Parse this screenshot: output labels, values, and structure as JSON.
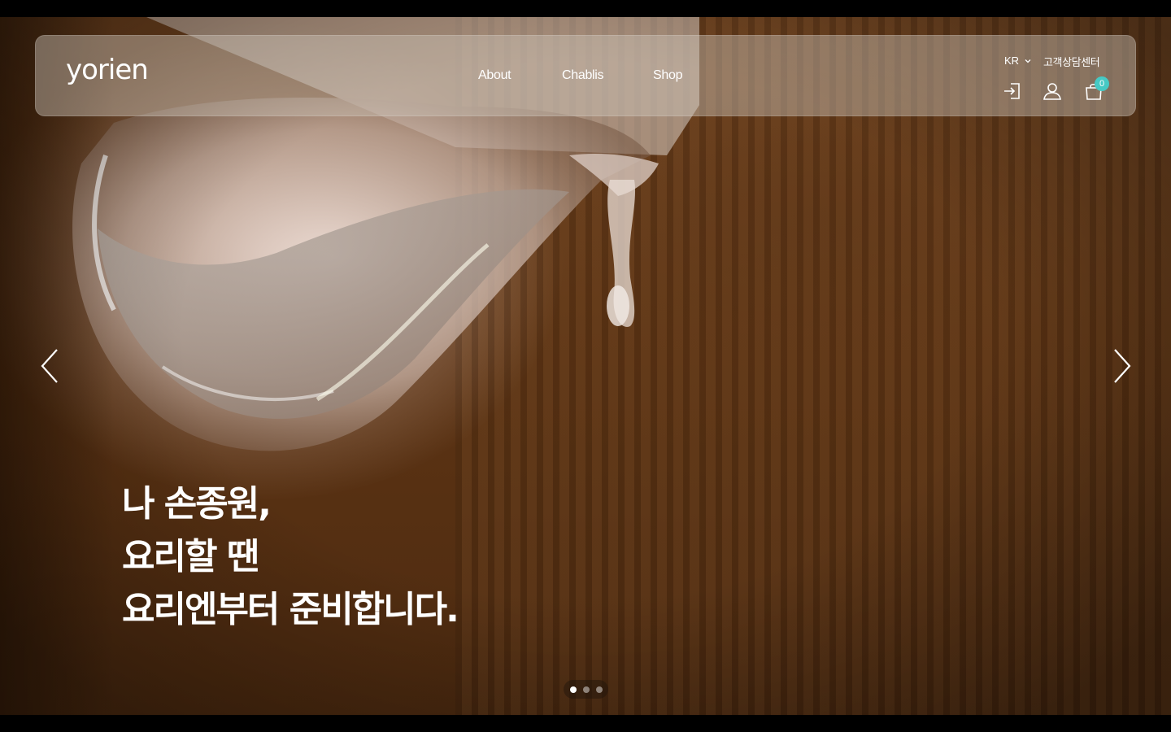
{
  "brand": {
    "logo_text": "yorien"
  },
  "nav": {
    "items": [
      {
        "label": "About"
      },
      {
        "label": "Chablis"
      },
      {
        "label": "Shop"
      }
    ]
  },
  "utility": {
    "language": "KR",
    "support_label": "고객상담센터",
    "cart_count": "0",
    "badge_color": "#46c9c4",
    "icons": [
      "login-icon",
      "user-icon",
      "cart-icon",
      "chevron-down-icon"
    ]
  },
  "hero": {
    "headline": {
      "line1": "나 손종원,",
      "line2": "요리할 땐",
      "line3": "요리엔부터 준비합니다."
    },
    "slides_total": 3,
    "active_slide": 1,
    "icons": [
      "chevron-left-icon",
      "chevron-right-icon"
    ]
  }
}
